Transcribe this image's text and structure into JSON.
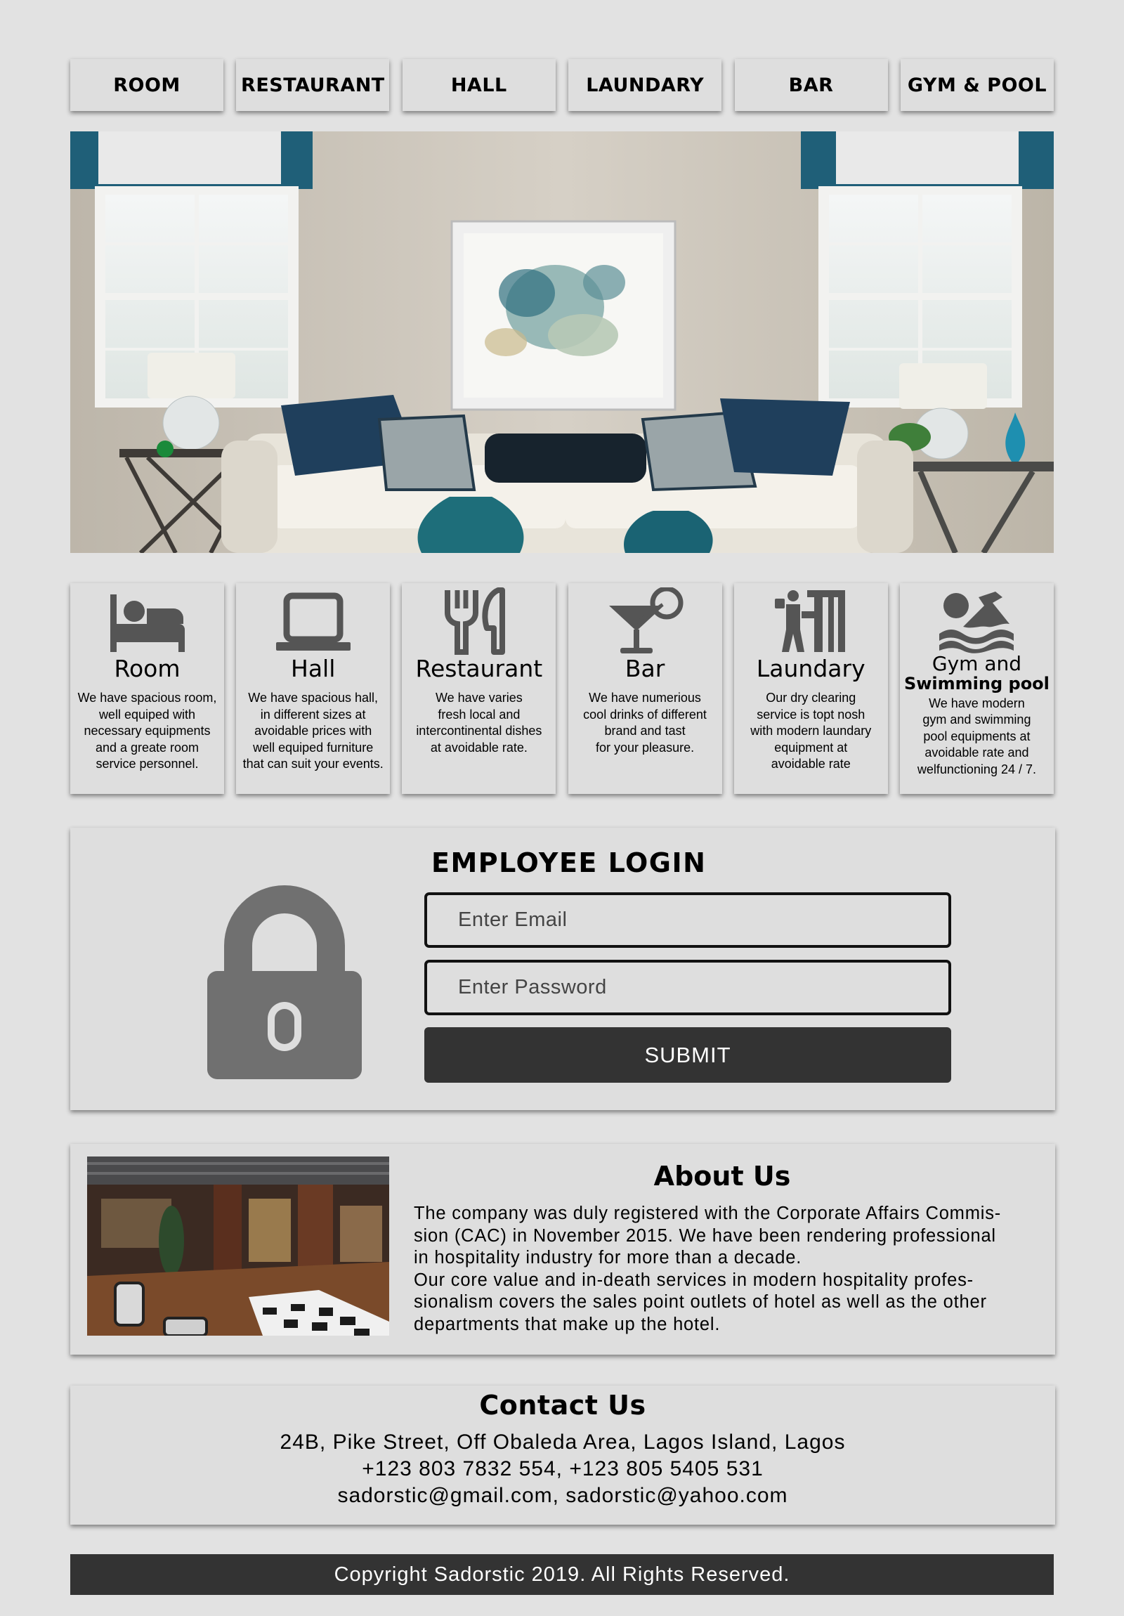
{
  "nav": {
    "items": [
      {
        "label": "ROOM"
      },
      {
        "label": "RESTAURANT"
      },
      {
        "label": "HALL"
      },
      {
        "label": "LAUNDARY"
      },
      {
        "label": "BAR"
      },
      {
        "label": "GYM & POOL"
      }
    ]
  },
  "hero": {
    "image": "living-room-photo"
  },
  "services": [
    {
      "icon": "bed-icon",
      "title": "Room",
      "desc": [
        "We have spacious room,",
        "well equiped with",
        "necessary equipments",
        "and a greate room",
        "service personnel."
      ]
    },
    {
      "icon": "laptop-icon",
      "title": "Hall",
      "desc": [
        "We have spacious hall,",
        "in different sizes at",
        "avoidable prices with",
        "well equiped furniture",
        "that can suit your events."
      ]
    },
    {
      "icon": "fork-knife-icon",
      "title": "Restaurant",
      "desc": [
        "We have varies",
        "fresh local and",
        "intercontinental dishes",
        "at avoidable rate."
      ]
    },
    {
      "icon": "cocktail-icon",
      "title": "Bar",
      "desc": [
        "We have numerious",
        "cool drinks of different",
        "brand and tast",
        "for your pleasure."
      ]
    },
    {
      "icon": "laundry-icon",
      "title": "Laundary",
      "desc": [
        "Our dry clearing",
        "service is topt nosh",
        "with modern laundary",
        "equipment at",
        "avoidable rate"
      ]
    },
    {
      "icon": "swimmer-icon",
      "title": "Gym and",
      "title2": "Swimming pool",
      "desc": [
        "We have modern",
        "gym and swimming",
        "pool equipments at",
        "avoidable rate and",
        "welfunctioning 24 / 7."
      ]
    }
  ],
  "login": {
    "title": "EMPLOYEE LOGIN",
    "email_placeholder": "Enter Email",
    "password_placeholder": "Enter Password",
    "submit_label": "SUBMIT"
  },
  "about": {
    "title": "About Us",
    "lines": [
      "The company was duly registered with the Corporate Affairs Commis-",
      "sion (CAC) in November 2015. We have been rendering professional",
      "in hospitality industry for more than a decade.",
      "Our core value and in-death services in modern hospitality profes-",
      "sionalism covers the sales point outlets of hotel as well as the other",
      "departments that make up the hotel."
    ]
  },
  "contact": {
    "title": "Contact Us",
    "address": "24B, Pike Street, Off Obaleda Area, Lagos Island, Lagos",
    "phones": "+123 803 7832 554,  +123 805 5405 531",
    "emails": "sadorstic@gmail.com, sadorstic@yahoo.com"
  },
  "footer": {
    "text": "Copyright Sadorstic 2019. All Rights Reserved."
  },
  "colors": {
    "background": "#e2e2e2",
    "card": "#dedede",
    "dark": "#333333",
    "icon": "#555555",
    "accent_teal": "#1f5f78"
  }
}
